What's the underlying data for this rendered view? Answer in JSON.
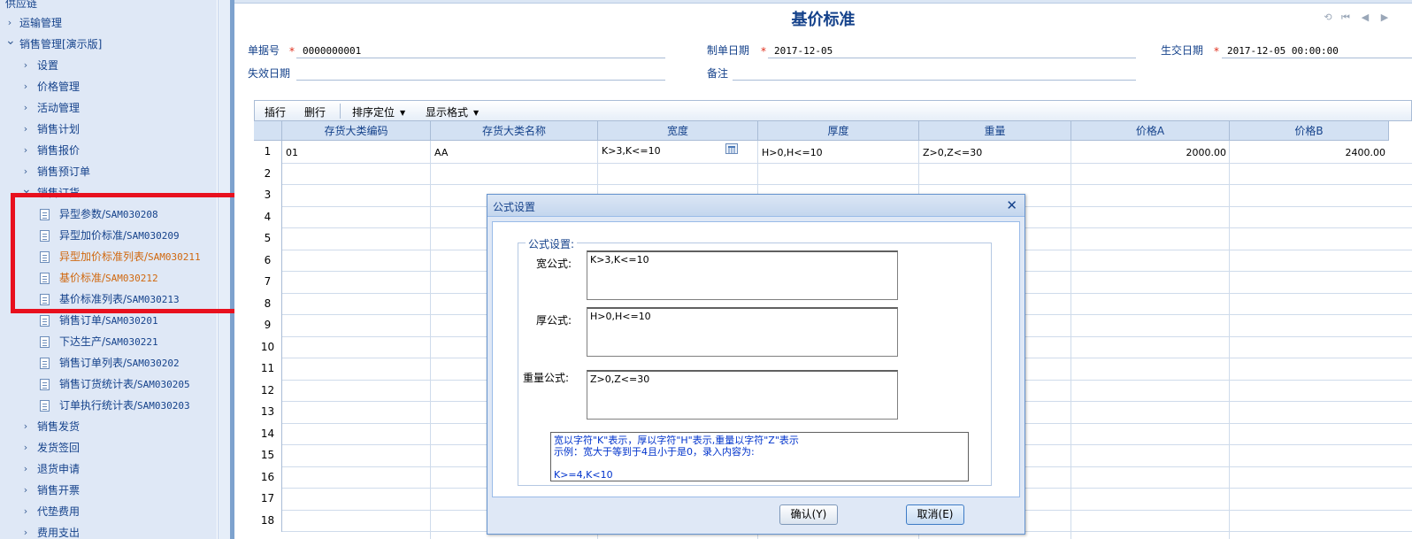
{
  "sidebar": {
    "top_item": "供应链",
    "items": [
      {
        "label": "运输管理",
        "level": 0,
        "type": "folder"
      },
      {
        "label": "销售管理[演示版]",
        "level": 0,
        "type": "folder-open"
      },
      {
        "label": "设置",
        "level": 1,
        "type": "folder"
      },
      {
        "label": "价格管理",
        "level": 1,
        "type": "folder"
      },
      {
        "label": "活动管理",
        "level": 1,
        "type": "folder"
      },
      {
        "label": "销售计划",
        "level": 1,
        "type": "folder"
      },
      {
        "label": "销售报价",
        "level": 1,
        "type": "folder"
      },
      {
        "label": "销售预订单",
        "level": 1,
        "type": "folder"
      },
      {
        "label": "销售订货",
        "level": 1,
        "type": "folder-open"
      },
      {
        "label": "异型参数/",
        "code": "SAM030208",
        "level": 2,
        "type": "doc"
      },
      {
        "label": "异型加价标准/",
        "code": "SAM030209",
        "level": 2,
        "type": "doc"
      },
      {
        "label": "异型加价标准列表/",
        "code": "SAM030211",
        "level": 2,
        "type": "doc",
        "state": "hover"
      },
      {
        "label": "基价标准/",
        "code": "SAM030212",
        "level": 2,
        "type": "doc",
        "state": "active"
      },
      {
        "label": "基价标准列表/",
        "code": "SAM030213",
        "level": 2,
        "type": "doc"
      },
      {
        "label": "销售订单/",
        "code": "SAM030201",
        "level": 2,
        "type": "doc"
      },
      {
        "label": "下达生产/",
        "code": "SAM030221",
        "level": 2,
        "type": "doc"
      },
      {
        "label": "销售订单列表/",
        "code": "SAM030202",
        "level": 2,
        "type": "doc"
      },
      {
        "label": "销售订货统计表/",
        "code": "SAM030205",
        "level": 2,
        "type": "doc"
      },
      {
        "label": "订单执行统计表/",
        "code": "SAM030203",
        "level": 2,
        "type": "doc"
      },
      {
        "label": "销售发货",
        "level": 1,
        "type": "folder"
      },
      {
        "label": "发货签回",
        "level": 1,
        "type": "folder"
      },
      {
        "label": "退货申请",
        "level": 1,
        "type": "folder"
      },
      {
        "label": "销售开票",
        "level": 1,
        "type": "folder"
      },
      {
        "label": "代垫费用",
        "level": 1,
        "type": "folder"
      },
      {
        "label": "费用支出",
        "level": 1,
        "type": "folder"
      }
    ]
  },
  "header": {
    "title": "基价标准",
    "fields": {
      "doc_no_label": "单据号",
      "doc_no_value": "0000000001",
      "created_label": "制单日期",
      "created_value": "2017-12-05",
      "effective_label": "生交日期",
      "effective_value": "2017-12-05 00:00:00",
      "expire_label": "失效日期",
      "expire_value": "",
      "remark_label": "备注",
      "remark_value": ""
    }
  },
  "toolbar": {
    "insert_row": "插行",
    "delete_row": "删行",
    "sort_locate": "排序定位",
    "display_format": "显示格式"
  },
  "grid": {
    "columns": [
      "存货大类编码",
      "存货大类名称",
      "宽度",
      "厚度",
      "重量",
      "价格A",
      "价格B"
    ],
    "row_numbers": [
      "1",
      "2",
      "3",
      "4",
      "5",
      "6",
      "7",
      "8",
      "9",
      "10",
      "11",
      "12",
      "13",
      "14",
      "15",
      "16",
      "17",
      "18"
    ],
    "rows": [
      [
        "01",
        "AA",
        "K>3,K<=10",
        "H>0,H<=10",
        "Z>0,Z<=30",
        "2000.00",
        "2400.00"
      ]
    ]
  },
  "dialog": {
    "title": "公式设置",
    "group_label": "公式设置:",
    "width_label": "宽公式:",
    "width_value": "K>3,K<=10",
    "thickness_label": "厚公式:",
    "thickness_value": "H>0,H<=10",
    "weight_label": "重量公式:",
    "weight_value": "Z>0,Z<=30",
    "hint_line1": "宽以字符\"K\"表示，厚以字符\"H\"表示,重量以字符\"Z\"表示",
    "hint_line2": "示例：宽大于等到于4且小于是0，录入内容为:",
    "hint_line3": "",
    "hint_line4": "K>=4,K<10",
    "confirm_label": "确认(Y)",
    "cancel_label": "取消(E)"
  },
  "colors": {
    "sidebar_bg": "#dfe8f6",
    "text_blue": "#15428b",
    "active_orange": "#d0680f",
    "highlight_red": "#e8101e",
    "required_star": "#e0301e",
    "hint_blue": "#0033cc"
  }
}
